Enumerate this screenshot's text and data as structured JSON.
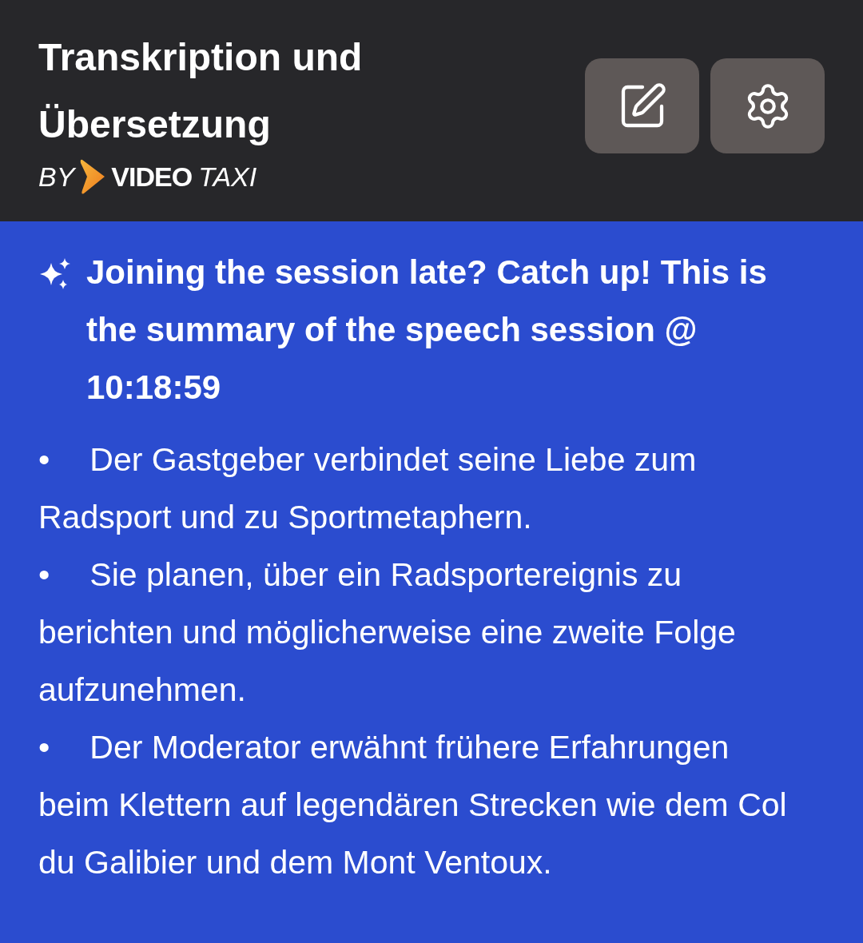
{
  "header": {
    "title": "Transkription und Übersetzung",
    "brand": {
      "by": "BY",
      "name_bold": "VIDEO",
      "name_light": "TAXI"
    },
    "buttons": [
      {
        "kind": "edit"
      },
      {
        "kind": "settings"
      }
    ]
  },
  "summary": {
    "heading": "Joining the session late? Catch up! This is the summary of the speech session @ 10:18:59",
    "items": [
      {
        "marker": "•",
        "text": "Der Gastgeber verbindet seine Liebe zum Radsport und zu Sportmetaphern."
      },
      {
        "marker": "•",
        "text": "Sie planen, über ein Radsportereignis zu berichten und möglicherweise eine zweite Folge aufzunehmen."
      },
      {
        "marker": "•",
        "text": "Der Moderator erwähnt frühere Erfahrungen beim Klettern auf legendären Strecken wie dem Col du Galibier und dem Mont Ventoux."
      }
    ]
  }
}
